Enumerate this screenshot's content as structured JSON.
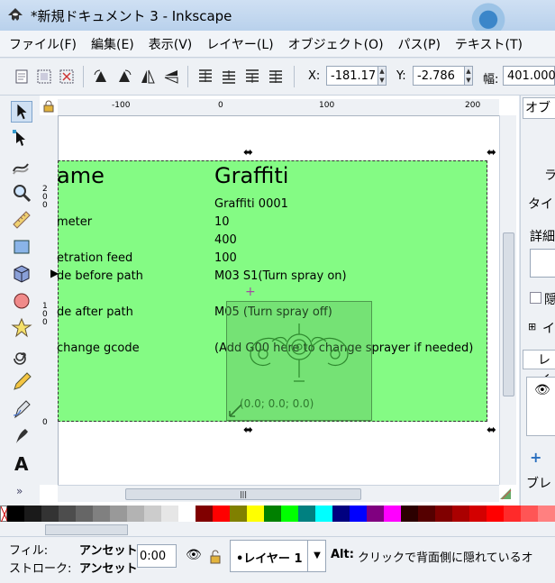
{
  "window": {
    "title": "*新規ドキュメント 3 - Inkscape"
  },
  "menu": [
    "ファイル(F)",
    "編集(E)",
    "表示(V)",
    "レイヤー(L)",
    "オブジェクト(O)",
    "パス(P)",
    "テキスト(T)"
  ],
  "controls": {
    "x_label": "X:",
    "x_value": "-181.17",
    "y_label": "Y:",
    "y_value": "-2.786",
    "w_label": "幅:",
    "w_value": "401.000"
  },
  "rulers": {
    "top": [
      "-100",
      "0",
      "100",
      "200"
    ],
    "left": [
      "2 0 0",
      "1 0 0",
      "0"
    ]
  },
  "graffiti": {
    "rows": [
      {
        "label": "ame",
        "value": "Graffiti"
      },
      {
        "label": "",
        "value": "Graffiti 0001"
      },
      {
        "label": "meter",
        "value": "10"
      },
      {
        "label": "",
        "value": "400"
      },
      {
        "label": "etration feed",
        "value": "100"
      },
      {
        "label": "de before path",
        "value": "M03 S1(Turn spray on)"
      },
      {
        "label": "de after path",
        "value": "M05 (Turn spray off)"
      },
      {
        "label": "change gcode",
        "value": "(Add G00 here to change sprayer if needed)"
      }
    ],
    "origin_label": "(0.0; 0.0; 0.0)"
  },
  "dock": {
    "tab_label": "オブ",
    "items": [
      "ラ",
      "タイ",
      "詳細",
      "隠",
      "イ",
      "レイ",
      "ブレ"
    ]
  },
  "palette": [
    "#000000",
    "#1a1a1a",
    "#333333",
    "#4d4d4d",
    "#666666",
    "#808080",
    "#999999",
    "#b3b3b3",
    "#cccccc",
    "#e6e6e6",
    "#ffffff",
    "#800000",
    "#ff0000",
    "#808000",
    "#ffff00",
    "#008000",
    "#00ff00",
    "#008080",
    "#00ffff",
    "#000080",
    "#0000ff",
    "#800080",
    "#ff00ff",
    "#2b0000",
    "#550000",
    "#800000",
    "#aa0000",
    "#d40000",
    "#ff0000",
    "#ff2a2a",
    "#ff5555",
    "#ff8080"
  ],
  "status": {
    "fill_label": "フィル:",
    "fill_value": "アンセット",
    "stroke_label": "ストローク:",
    "stroke_value": "アンセット",
    "opacity_value": "0:00",
    "layer_value": "•レイヤー 1",
    "message_key": "Alt:",
    "message": "クリックで背面側に隠れているオ"
  }
}
